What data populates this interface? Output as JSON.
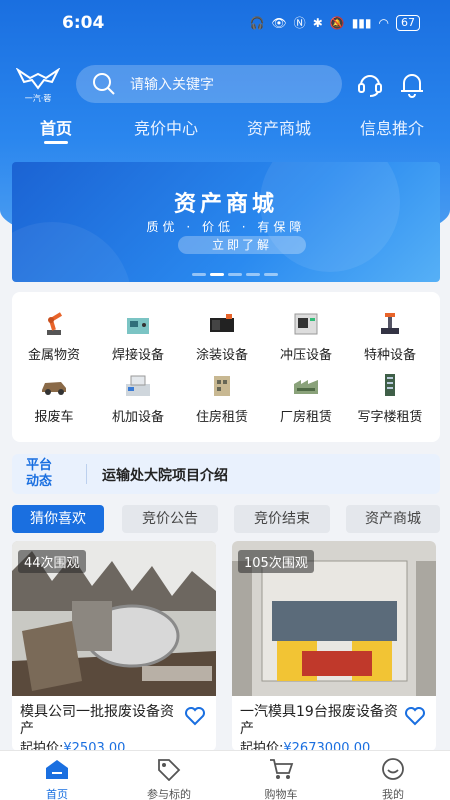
{
  "status": {
    "time": "6:04",
    "battery": "67"
  },
  "header": {
    "logo_text": "一汽·蓉",
    "search_placeholder": "请输入关键字"
  },
  "nav_tabs": [
    {
      "label": "首页",
      "active": true
    },
    {
      "label": "竞价中心",
      "active": false
    },
    {
      "label": "资产商城",
      "active": false
    },
    {
      "label": "信息推介",
      "active": false
    }
  ],
  "banner": {
    "title": "资产商城",
    "subtitle": "质优 · 价低 · 有保障",
    "button": "立即了解"
  },
  "categories": [
    {
      "label": "金属物资",
      "icon": "robot-arm-icon"
    },
    {
      "label": "焊接设备",
      "icon": "welding-machine-icon"
    },
    {
      "label": "涂装设备",
      "icon": "paint-equipment-icon"
    },
    {
      "label": "冲压设备",
      "icon": "press-machine-icon"
    },
    {
      "label": "特种设备",
      "icon": "special-equipment-icon"
    },
    {
      "label": "报废车",
      "icon": "scrap-car-icon"
    },
    {
      "label": "机加设备",
      "icon": "machining-icon"
    },
    {
      "label": "住房租赁",
      "icon": "housing-icon"
    },
    {
      "label": "厂房租赁",
      "icon": "factory-icon"
    },
    {
      "label": "写字楼租赁",
      "icon": "office-icon"
    }
  ],
  "news": {
    "tag": "平台动态",
    "text": "运输处大院项目介绍"
  },
  "filter_tabs": [
    {
      "label": "猜你喜欢",
      "active": true
    },
    {
      "label": "竞价公告",
      "active": false
    },
    {
      "label": "竞价结束",
      "active": false
    },
    {
      "label": "资产商城",
      "active": false
    }
  ],
  "listings": [
    {
      "views": "44次围观",
      "title": "模具公司一批报废设备资产",
      "price_label": "起拍价:",
      "price": "¥2503.00"
    },
    {
      "views": "105次围观",
      "title": "一汽模具19台报废设备资产",
      "price_label": "起拍价:",
      "price": "¥2673000.00"
    }
  ],
  "bottom_nav": [
    {
      "label": "首页",
      "icon": "home-icon",
      "active": true
    },
    {
      "label": "参与标的",
      "icon": "tag-icon",
      "active": false
    },
    {
      "label": "购物车",
      "icon": "cart-icon",
      "active": false
    },
    {
      "label": "我的",
      "icon": "profile-icon",
      "active": false
    }
  ],
  "colors": {
    "primary": "#1a6fe0",
    "background": "#f1f3f7"
  }
}
